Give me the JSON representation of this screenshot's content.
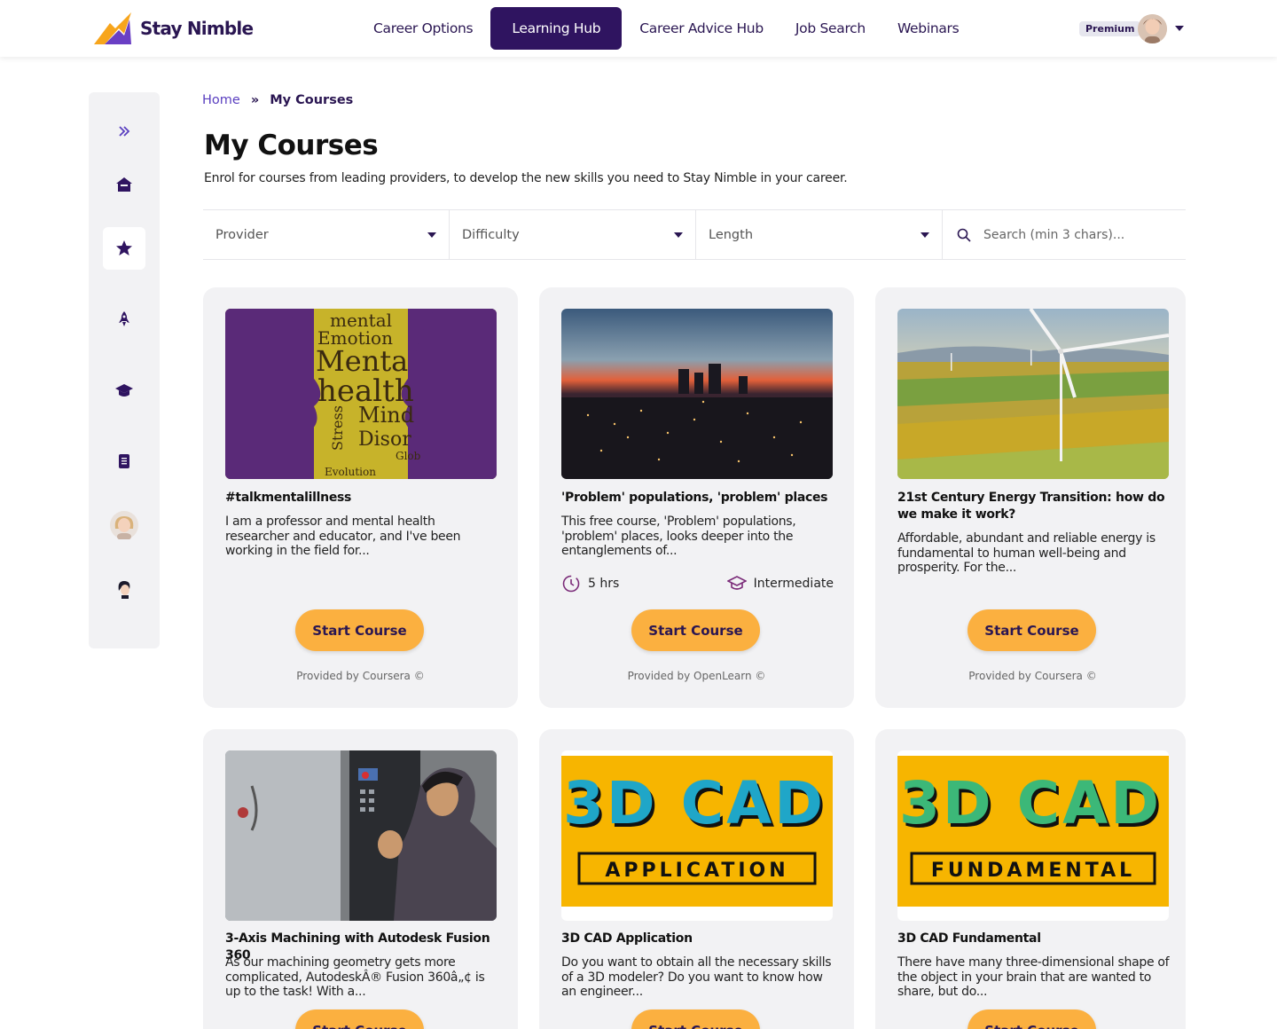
{
  "brand": {
    "name": "Stay Nimble"
  },
  "nav": [
    "Career Options",
    "Learning Hub",
    "Career Advice Hub",
    "Job Search",
    "Webinars"
  ],
  "user": {
    "badge": "Premium"
  },
  "breadcrumb": {
    "home": "Home",
    "sep": "»",
    "current": "My Courses"
  },
  "page": {
    "title": "My Courses",
    "description": "Enrol for courses from leading providers, to develop the new skills you need to Stay Nimble in your career."
  },
  "filters": {
    "provider": "Provider",
    "difficulty": "Difficulty",
    "length": "Length",
    "search_placeholder": "Search (min 3 chars)..."
  },
  "cards": [
    {
      "title": "#talkmentalillness",
      "desc": "I am a professor and mental health researcher and educator, and I've been working in the field for...",
      "button": "Start Course",
      "provider": "Provided by Coursera ©"
    },
    {
      "title": "'Problem' populations, 'problem' places",
      "desc": "This free course, 'Problem' populations, 'problem' places, looks deeper into the entanglements of...",
      "duration": "5 hrs",
      "level": "Intermediate",
      "button": "Start Course",
      "provider": "Provided by OpenLearn ©"
    },
    {
      "title": "21st Century Energy Transition: how do we make it work?",
      "desc": "Affordable, abundant and reliable energy is fundamental to human well-being and prosperity. For the...",
      "button": "Start Course",
      "provider": "Provided by Coursera ©"
    },
    {
      "title": "3-Axis Machining with Autodesk Fusion 360",
      "desc": "As our machining geometry gets more complicated, AutodeskÂ® Fusion 360â„¢ is up to the task! With a...",
      "button": "Start Course"
    },
    {
      "title": "3D CAD Application",
      "desc": "Do you want to obtain all the necessary skills of a 3D modeler? Do you want to know how an engineer...",
      "button": "Start Course",
      "image_text": {
        "top": "3D CAD",
        "bottom": "APPLICATION"
      }
    },
    {
      "title": "3D CAD Fundamental",
      "desc": "There have many three-dimensional shape of the object in your brain that are wanted to share, but do...",
      "button": "Start Course",
      "image_text": {
        "top": "3D CAD",
        "bottom": "FUNDAMENTAL"
      }
    }
  ],
  "card1_image_words": [
    "mental",
    "Emotion",
    "Menta",
    "health",
    "Mind",
    "Stress",
    "Disor",
    "Glob",
    "Evolution"
  ],
  "icons": [
    "expand-icon",
    "home-icon",
    "star-icon",
    "rocket-icon",
    "graduation-cap-icon",
    "notebook-icon",
    "avatar",
    "avatar",
    "clock-icon",
    "mortarboard-icon",
    "search-icon",
    "dropdown-caret-icon"
  ],
  "colors": {
    "primary": "#2f1460",
    "accent": "#fbb040",
    "link": "#5a3fc0",
    "card_bg": "#f2f2f4"
  }
}
